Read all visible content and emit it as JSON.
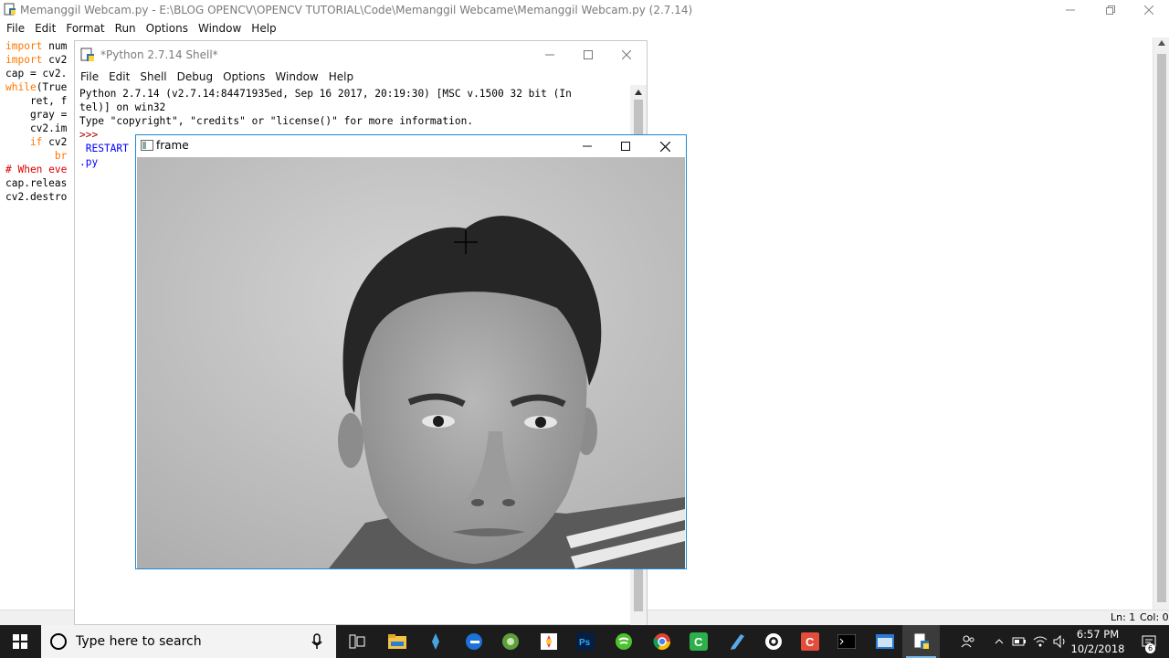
{
  "editor": {
    "title": "Memanggil Webcam.py - E:\\BLOG OPENCV\\OPENCV TUTORIAL\\Code\\Memanggil Webcame\\Memanggil Webcam.py (2.7.14)",
    "menu": [
      "File",
      "Edit",
      "Format",
      "Run",
      "Options",
      "Window",
      "Help"
    ],
    "code_lines": [
      {
        "k": "import",
        "t": " num"
      },
      {
        "k": "import",
        "t": " cv2"
      },
      {
        "k": "",
        "t": "cap = cv2."
      },
      {
        "k": "while",
        "t": "(True"
      },
      {
        "k": "",
        "t": "    ret, f"
      },
      {
        "k": "",
        "t": "    gray ="
      },
      {
        "k": "",
        "t": "    cv2.im"
      },
      {
        "k": "    if",
        "t": " cv2"
      },
      {
        "k": "        br",
        "t": ""
      },
      {
        "c": "# When eve"
      },
      {
        "k": "",
        "t": "cap.releas"
      },
      {
        "k": "",
        "t": "cv2.destro"
      }
    ],
    "status": {
      "ln": "Ln: 1",
      "col": "Col: 0"
    }
  },
  "shell": {
    "title": "*Python 2.7.14 Shell*",
    "menu": [
      "File",
      "Edit",
      "Shell",
      "Debug",
      "Options",
      "Window",
      "Help"
    ],
    "line1": "Python 2.7.14 (v2.7.14:84471935ed, Sep 16 2017, 20:19:30) [MSC v.1500 32 bit (In",
    "line2": "tel)] on win32",
    "line3": "Type \"copyright\", \"credits\" or \"license()\" for more information.",
    "prompt": ">>>",
    "restart": " RESTART",
    "py": ".py"
  },
  "frame": {
    "title": "frame",
    "content": "grayscale webcam image of a young man with dark hair wearing a striped shirt"
  },
  "taskbar": {
    "search_placeholder": "Type here to search",
    "time": "6:57 PM",
    "date": "10/2/2018",
    "notification_count": "6",
    "apps": [
      "task-view-icon",
      "file-explorer-icon",
      "sourcetree-icon",
      "edge-icon",
      "android-studio-icon",
      "inkscape-icon",
      "photoshop-icon",
      "spotify-icon",
      "chrome-icon",
      "camtasia-icon",
      "editor-icon",
      "obs-icon",
      "codeblocks-icon",
      "cmd-icon",
      "terminal-icon",
      "python-idle-icon"
    ]
  },
  "colors": {
    "keyword": "#ff7700",
    "comment": "#dd0000",
    "builtin": "#900090",
    "shell_output": "#0000ff",
    "taskbar": "#1c1c1c",
    "frame_border": "#1f8ad2"
  }
}
